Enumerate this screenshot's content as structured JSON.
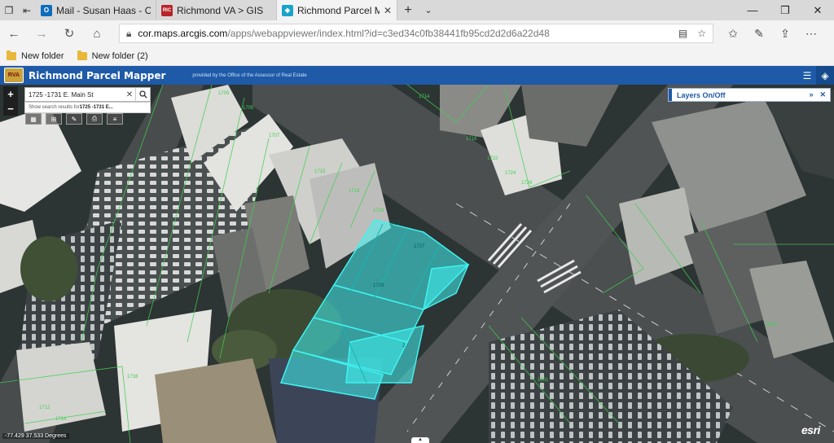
{
  "browser": {
    "tabs": [
      {
        "title": "Mail - Susan Haas - Outlook",
        "favicon_text": "O",
        "favicon_color": "#0f6cbd",
        "active": false
      },
      {
        "title": "Richmond VA > GIS",
        "favicon_text": "RIC",
        "favicon_color": "#b8242a",
        "active": false
      },
      {
        "title": "Richmond Parcel Mapper",
        "favicon_text": "◆",
        "favicon_color": "#1aa3c9",
        "active": true
      }
    ],
    "address": {
      "host": "cor.maps.arcgis.com",
      "path": "/apps/webappviewer/index.html?id=c3ed34c0fb38441fb95cd2d2d6a22d48"
    },
    "favorites": [
      {
        "label": "New folder"
      },
      {
        "label": "New folder (2)"
      }
    ]
  },
  "app": {
    "logo_text": "RVA",
    "title": "Richmond Parcel Mapper",
    "subtitle": "provided by the Office of the Assessor of Real Estate"
  },
  "search": {
    "value": "1725 -1731 E. Main St",
    "suggestion_prefix": "Show search results for ",
    "suggestion_query": "1725 -1731 E..."
  },
  "layers_panel": {
    "title": "Layers On/Off"
  },
  "map": {
    "coordinates": "-77.429 37.533 Degrees",
    "esri_label": "esri",
    "parcel_labels": [
      "1705",
      "1707",
      "1715",
      "1719",
      "1723",
      "1725",
      "1727",
      "1729",
      "1714",
      "1716",
      "1722",
      "1724",
      "1726",
      "1712",
      "1714",
      "1716",
      "1801",
      "1819",
      "2"
    ],
    "highlight_color": "#3ff2f0",
    "parcel_line_color": "#3fcf4f"
  }
}
